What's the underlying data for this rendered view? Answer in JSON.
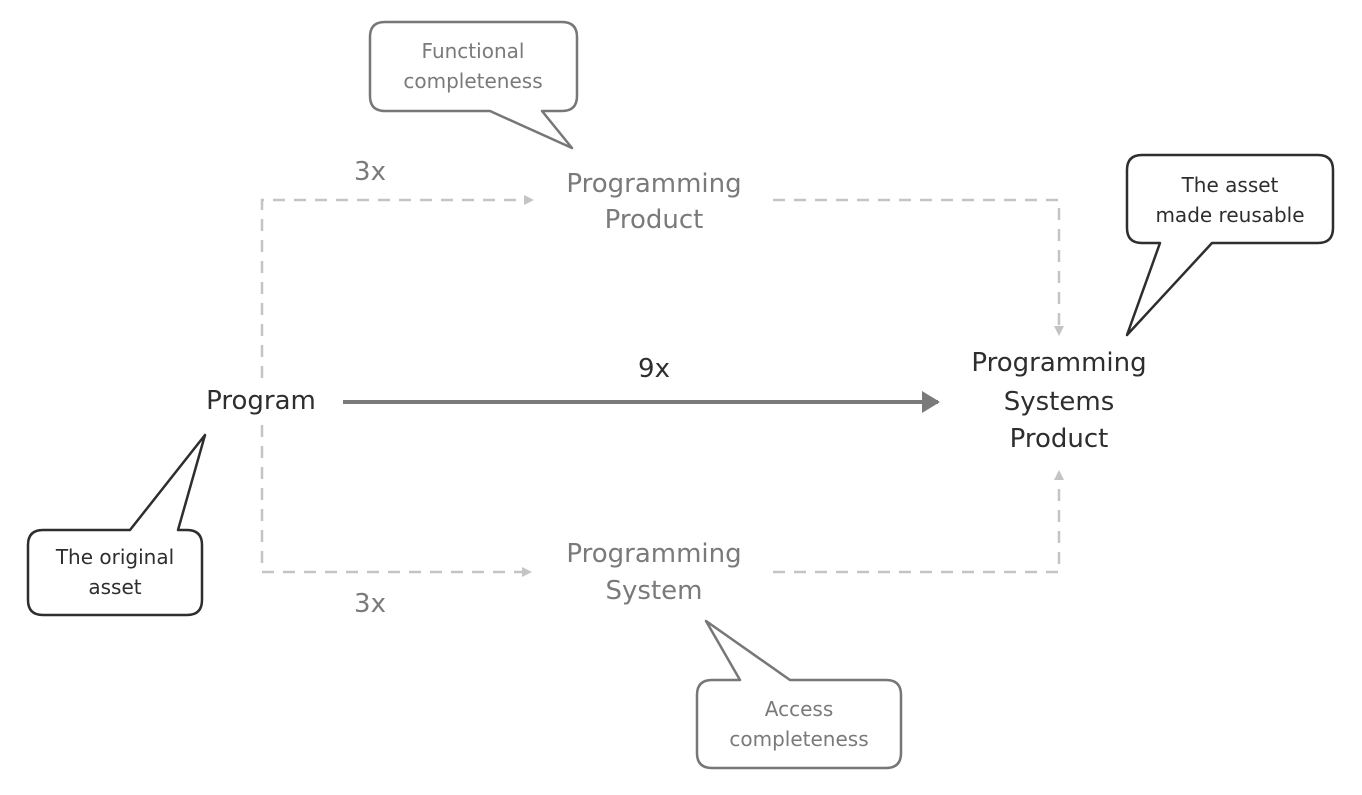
{
  "nodes": {
    "program": "Program",
    "product": [
      "Programming",
      "Product"
    ],
    "system": [
      "Programming",
      "System"
    ],
    "systems_product": [
      "Programming",
      "Systems",
      "Product"
    ]
  },
  "edges": {
    "program_to_product": "3x",
    "program_to_system": "3x",
    "program_to_systems_product": "9x"
  },
  "callouts": {
    "functional": [
      "Functional",
      "completeness"
    ],
    "access": [
      "Access",
      "completeness"
    ],
    "original": [
      "The original",
      "asset"
    ],
    "reusable": [
      "The asset",
      "made reusable"
    ]
  },
  "colors": {
    "primary_text": "#2e2e2e",
    "secondary_text": "#7a7a7a",
    "dashed_edge": "#c4c4c4",
    "main_arrow": "#7a7a7a"
  }
}
